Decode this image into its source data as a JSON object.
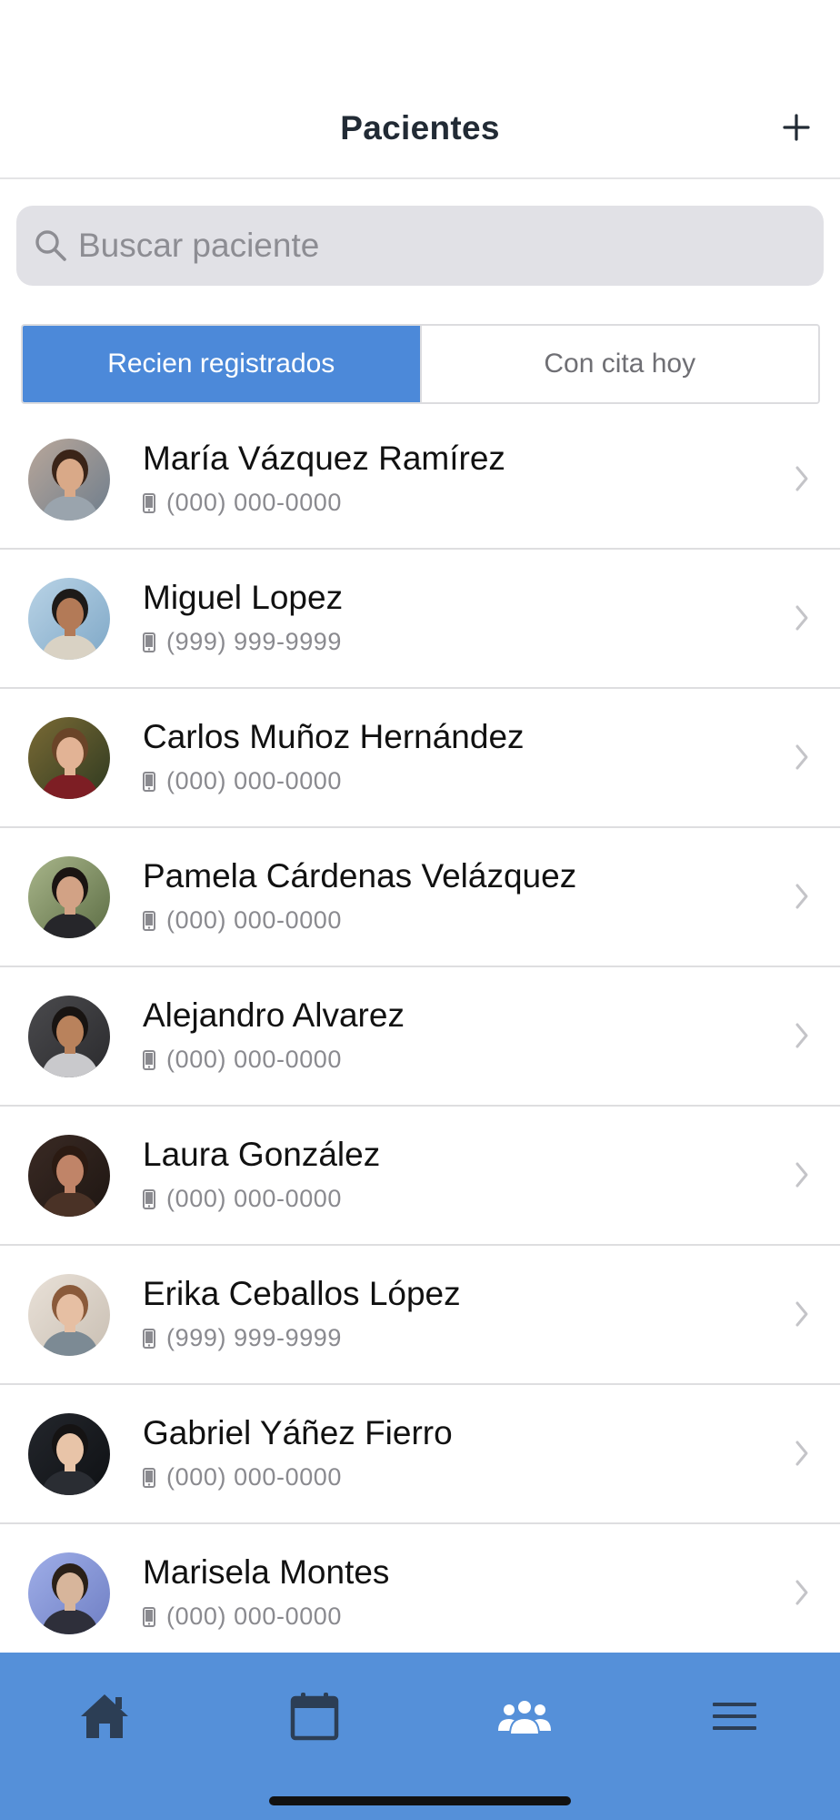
{
  "header": {
    "title": "Pacientes",
    "add_icon": "plus-icon"
  },
  "search": {
    "placeholder": "Buscar paciente",
    "value": "",
    "icon": "search-icon"
  },
  "segments": [
    {
      "label": "Recien registrados",
      "active": true
    },
    {
      "label": "Con cita hoy",
      "active": false
    }
  ],
  "patients": [
    {
      "name": "María Vázquez Ramírez",
      "phone": "(000) 000-0000"
    },
    {
      "name": "Miguel Lopez",
      "phone": "(999) 999-9999"
    },
    {
      "name": "Carlos Muñoz Hernández",
      "phone": "(000) 000-0000"
    },
    {
      "name": "Pamela Cárdenas Velázquez",
      "phone": "(000) 000-0000"
    },
    {
      "name": "Alejandro Alvarez",
      "phone": "(000) 000-0000"
    },
    {
      "name": "Laura González",
      "phone": "(000) 000-0000"
    },
    {
      "name": "Erika Ceballos López",
      "phone": "(999) 999-9999"
    },
    {
      "name": "Gabriel Yáñez Fierro",
      "phone": "(000) 000-0000"
    },
    {
      "name": "Marisela Montes",
      "phone": "(000) 000-0000"
    }
  ],
  "tabbar": {
    "items": [
      {
        "icon": "home-icon",
        "active": false
      },
      {
        "icon": "calendar-icon",
        "active": false
      },
      {
        "icon": "patients-icon",
        "active": true
      },
      {
        "icon": "menu-icon",
        "active": false
      }
    ]
  },
  "colors": {
    "accent": "#4c89d9",
    "tabbar": "#5590d9",
    "tab_icon_inactive": "#2c3e55",
    "tab_icon_active": "#ffffff"
  }
}
